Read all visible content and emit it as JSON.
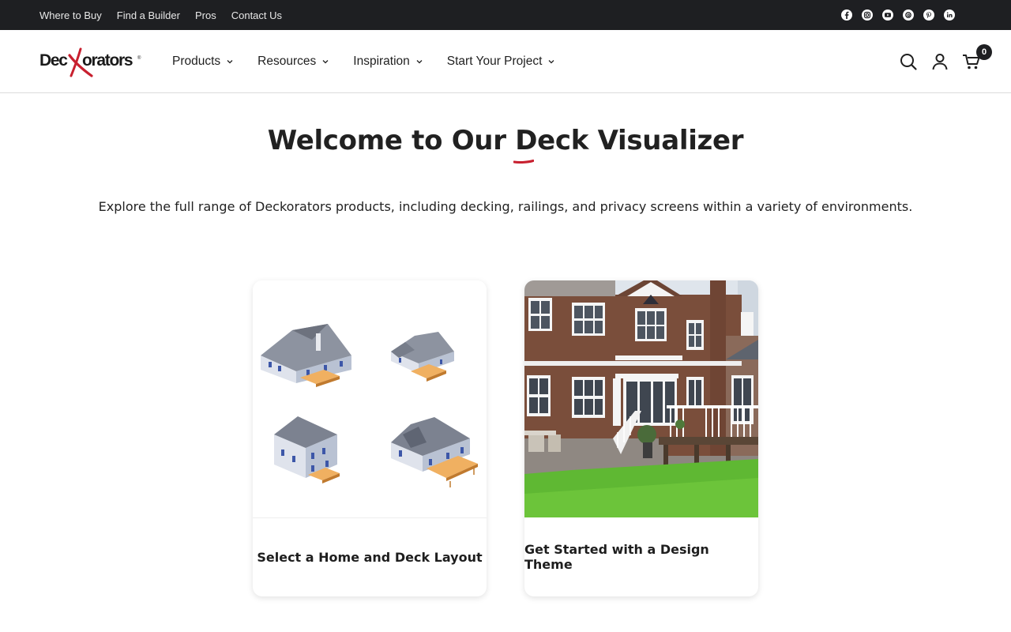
{
  "topbar": {
    "links": [
      "Where to Buy",
      "Find a Builder",
      "Pros",
      "Contact Us"
    ],
    "social_icons": [
      "facebook-icon",
      "instagram-icon",
      "youtube-icon",
      "threads-icon",
      "pinterest-icon",
      "linkedin-icon"
    ]
  },
  "header": {
    "logo_text": "Deckorators",
    "nav": [
      "Products",
      "Resources",
      "Inspiration",
      "Start Your Project"
    ],
    "icons": [
      "search-icon",
      "account-icon",
      "cart-icon"
    ],
    "cart_count": "0"
  },
  "hero": {
    "title": "Welcome to Our Deck Visualizer",
    "subtitle": "Explore the full range of Deckorators products, including decking, railings, and privacy screens within a variety of environments."
  },
  "cards": [
    {
      "label": "Select a Home and Deck Layout"
    },
    {
      "label": "Get Started with a Design Theme"
    }
  ],
  "colors": {
    "topbar_bg": "#1e1f22",
    "brand_red": "#c8202f",
    "text": "#212121"
  }
}
